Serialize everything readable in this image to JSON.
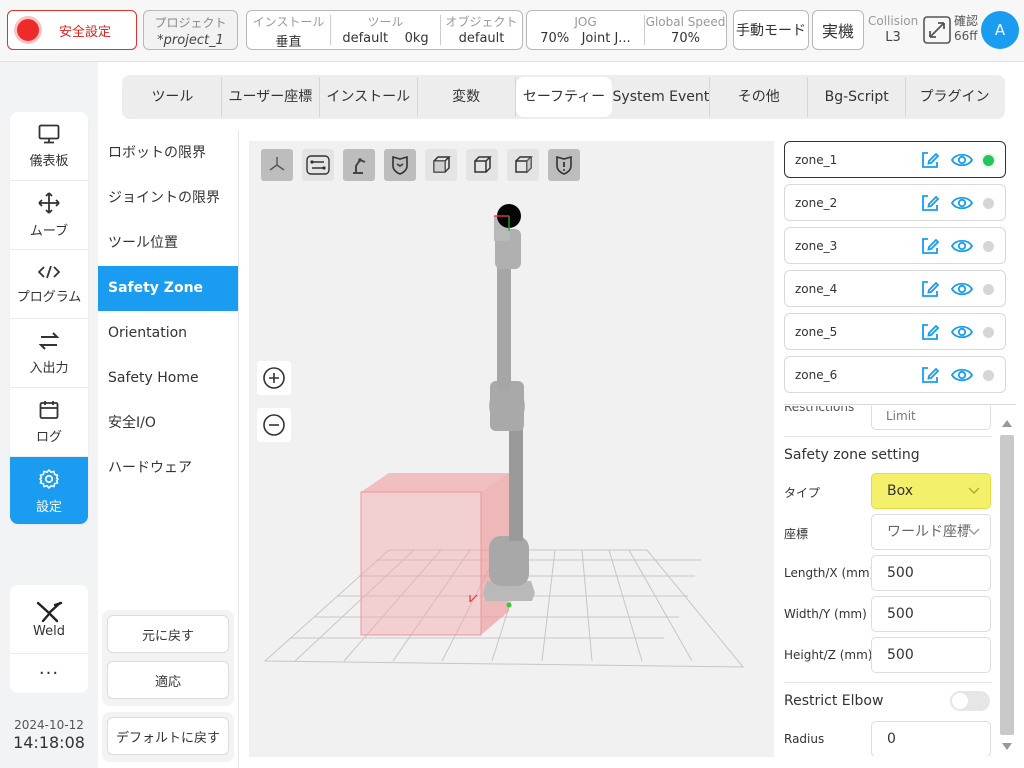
{
  "topbar": {
    "safety_label": "安全設定",
    "project_title": "プロジェクト",
    "project_value": "*project_1",
    "install_title": "インストール",
    "install_value": "垂直",
    "tool_title": "ツール",
    "tool_value": "default",
    "tool_weight": "0kg",
    "object_title": "オブジェクト",
    "object_value": "default",
    "jog_title": "JOG",
    "jog_value": "70%",
    "jog_mode": "Joint J...",
    "speed_title": "Global Speed",
    "speed_value": "70%",
    "manual_mode": "手動モード",
    "real_label": "実機",
    "collision_title": "Collision",
    "collision_value": "L3",
    "confirm_label": "確認",
    "confirm_value": "66ff",
    "avatar_letter": "A"
  },
  "nav": {
    "items": [
      {
        "label": "儀表板",
        "icon": "monitor-icon"
      },
      {
        "label": "ムーブ",
        "icon": "move-arrows-icon"
      },
      {
        "label": "プログラム",
        "icon": "code-icon"
      },
      {
        "label": "入出力",
        "icon": "exchange-icon"
      },
      {
        "label": "ログ",
        "icon": "calendar-icon"
      },
      {
        "label": "設定",
        "icon": "gear-icon"
      }
    ],
    "weld_label": "Weld",
    "more_label": "···"
  },
  "clock": {
    "date": "2024-10-12",
    "time": "14:18:08"
  },
  "tabs": [
    "ツール",
    "ユーザー座標",
    "インストール",
    "変数",
    "セーフティー",
    "System Event",
    "その他",
    "Bg-Script",
    "プラグイン"
  ],
  "submenu": [
    "ロボットの限界",
    "ジョイントの限界",
    "ツール位置",
    "Safety Zone",
    "Orientation",
    "Safety Home",
    "安全I/O",
    "ハードウェア"
  ],
  "actions": {
    "undo": "元に戻す",
    "apply": "適応",
    "default": "デフォルトに戻す"
  },
  "zones": [
    "zone_1",
    "zone_2",
    "zone_3",
    "zone_4",
    "zone_5",
    "zone_6"
  ],
  "settings": {
    "cut_label": "Restrictions",
    "cut_value": "Limit",
    "section_title": "Safety zone setting",
    "type_label": "タイプ",
    "type_value": "Box",
    "coord_label": "座標",
    "coord_value": "ワールド座標",
    "length_label": "Length/X (mm)",
    "length_value": "500",
    "width_label": "Width/Y (mm)",
    "width_value": "500",
    "height_label": "Height/Z (mm)",
    "height_value": "500",
    "elbow_label": "Restrict Elbow",
    "radius_label": "Radius",
    "radius_value": "0"
  },
  "colors": {
    "accent": "#1a9df0",
    "danger": "#ee2b2b",
    "active_zone": "#22c55e",
    "type_highlight": "#f5f06a"
  }
}
